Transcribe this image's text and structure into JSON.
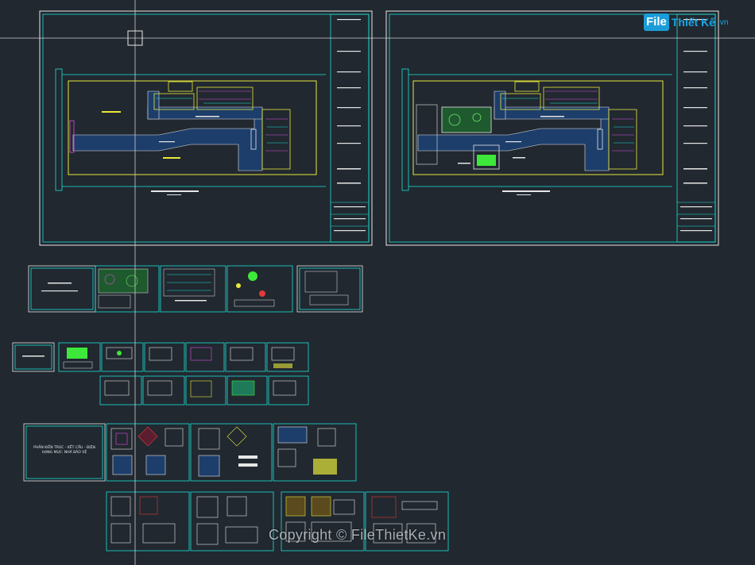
{
  "logo": {
    "brand_box": "File",
    "brand_text": "Thiết Kế",
    "brand_domain": ".vn"
  },
  "watermark": "Copyright © FileThietKe.vn",
  "title_block": {
    "lines": [
      "PHẦN KIẾN TRÚC - KẾT CẤU - ĐIỆN",
      "HẠNG MỤC: NHÀ BẢO VỆ"
    ]
  },
  "colors": {
    "background": "#212830",
    "sheet_frame": "#e6e6e6",
    "cyan": "#19e3d8",
    "yellow": "#e8e83a",
    "green": "#3ee83a",
    "magenta": "#e04ee0",
    "red": "#e23a3a",
    "blue_fill": "#1d3e6b",
    "crosshair": "#d0d0d0"
  },
  "icons": [
    "crosshair-cursor-icon",
    "pickbox-icon"
  ]
}
